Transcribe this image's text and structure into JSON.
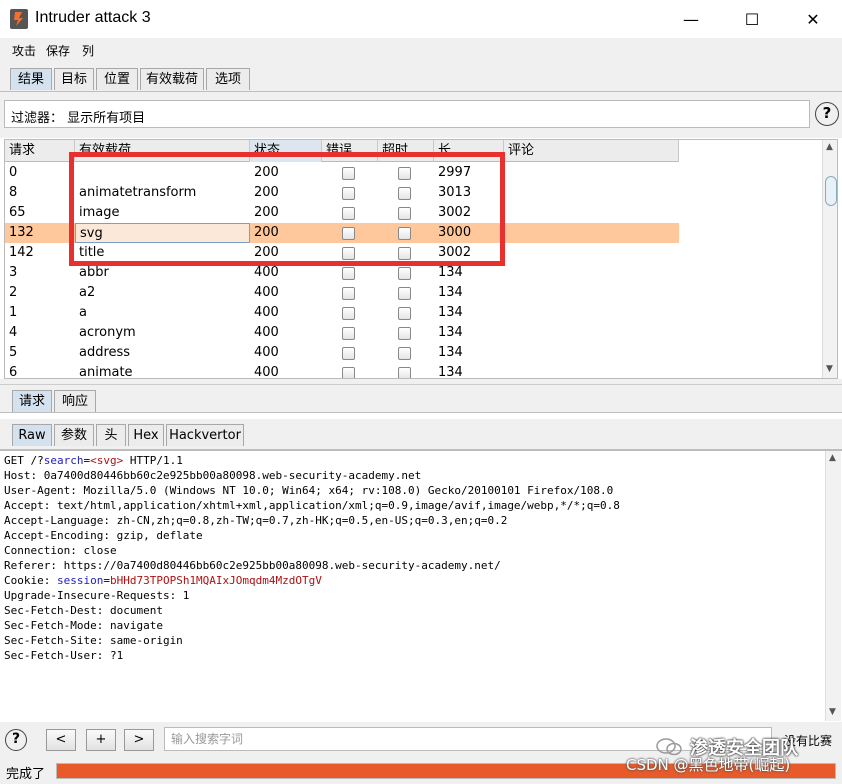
{
  "window": {
    "title": "Intruder attack 3"
  },
  "window_controls": {
    "minimize": "—",
    "maximize": "☐",
    "close": "✕"
  },
  "menu": [
    "攻击",
    "保存",
    "列"
  ],
  "top_tabs": [
    {
      "label": "结果",
      "active": true
    },
    {
      "label": "目标",
      "active": false
    },
    {
      "label": "位置",
      "active": false
    },
    {
      "label": "有效载荷",
      "active": false
    },
    {
      "label": "选项",
      "active": false
    }
  ],
  "filter": {
    "label": "过滤器：  显示所有项目",
    "help": "?"
  },
  "results_table": {
    "columns": [
      "请求",
      "有效载荷",
      "状态",
      "错误",
      "超时",
      "长",
      "评论"
    ],
    "rows": [
      {
        "request": "0",
        "payload": "",
        "status": "200",
        "error": false,
        "timeout": false,
        "length": "2997",
        "comment": "",
        "selected": false
      },
      {
        "request": "8",
        "payload": "animatetransform",
        "status": "200",
        "error": false,
        "timeout": false,
        "length": "3013",
        "comment": "",
        "selected": false
      },
      {
        "request": "65",
        "payload": "image",
        "status": "200",
        "error": false,
        "timeout": false,
        "length": "3002",
        "comment": "",
        "selected": false
      },
      {
        "request": "132",
        "payload": "svg",
        "status": "200",
        "error": false,
        "timeout": false,
        "length": "3000",
        "comment": "",
        "selected": true
      },
      {
        "request": "142",
        "payload": "title",
        "status": "200",
        "error": false,
        "timeout": false,
        "length": "3002",
        "comment": "",
        "selected": false
      },
      {
        "request": "3",
        "payload": "abbr",
        "status": "400",
        "error": false,
        "timeout": false,
        "length": "134",
        "comment": "",
        "selected": false
      },
      {
        "request": "2",
        "payload": "a2",
        "status": "400",
        "error": false,
        "timeout": false,
        "length": "134",
        "comment": "",
        "selected": false
      },
      {
        "request": "1",
        "payload": "a",
        "status": "400",
        "error": false,
        "timeout": false,
        "length": "134",
        "comment": "",
        "selected": false
      },
      {
        "request": "4",
        "payload": "acronym",
        "status": "400",
        "error": false,
        "timeout": false,
        "length": "134",
        "comment": "",
        "selected": false
      },
      {
        "request": "5",
        "payload": "address",
        "status": "400",
        "error": false,
        "timeout": false,
        "length": "134",
        "comment": "",
        "selected": false
      },
      {
        "request": "6",
        "payload": "animate",
        "status": "400",
        "error": false,
        "timeout": false,
        "length": "134",
        "comment": "",
        "selected": false
      }
    ]
  },
  "highlight_box_color": "#e8302f",
  "detail_tabs": [
    {
      "label": "请求",
      "active": true
    },
    {
      "label": "响应",
      "active": false
    }
  ],
  "view_tabs": [
    {
      "label": "Raw",
      "active": true
    },
    {
      "label": "参数",
      "active": false
    },
    {
      "label": "头",
      "active": false
    },
    {
      "label": "Hex",
      "active": false
    },
    {
      "label": "Hackvertor",
      "active": false
    }
  ],
  "request": {
    "line1": {
      "method": "GET /?",
      "param": "search",
      "eq": "=",
      "value": "<svg>",
      "proto": " HTTP/1.1"
    },
    "headers": [
      "Host: 0a7400d80446bb60c2e925bb00a80098.web-security-academy.net",
      "User-Agent: Mozilla/5.0 (Windows NT 10.0; Win64; x64; rv:108.0) Gecko/20100101 Firefox/108.0",
      "Accept: text/html,application/xhtml+xml,application/xml;q=0.9,image/avif,image/webp,*/*;q=0.8",
      "Accept-Language: zh-CN,zh;q=0.8,zh-TW;q=0.7,zh-HK;q=0.5,en-US;q=0.3,en;q=0.2",
      "Accept-Encoding: gzip, deflate",
      "Connection: close",
      "Referer: https://0a7400d80446bb60c2e925bb00a80098.web-security-academy.net/"
    ],
    "cookie": {
      "prefix": "Cookie: ",
      "name": "session",
      "eq": "=",
      "value": "bHHd73TPOPSh1MQAIxJOmqdm4MzdOTgV"
    },
    "headers_after": [
      "Upgrade-Insecure-Requests: 1",
      "Sec-Fetch-Dest: document",
      "Sec-Fetch-Mode: navigate",
      "Sec-Fetch-Site: same-origin",
      "Sec-Fetch-User: ?1"
    ]
  },
  "search_bar": {
    "help": "?",
    "prev": "<",
    "add": "+",
    "next": ">",
    "placeholder": "输入搜索字词",
    "match_text": "没有比赛"
  },
  "status": {
    "text": "完成了",
    "progress_percent": 100,
    "progress_color": "#e85a2a"
  },
  "watermark": {
    "line1": "渗透安全团队",
    "line2": "CSDN @黑色地带(崛起)"
  }
}
